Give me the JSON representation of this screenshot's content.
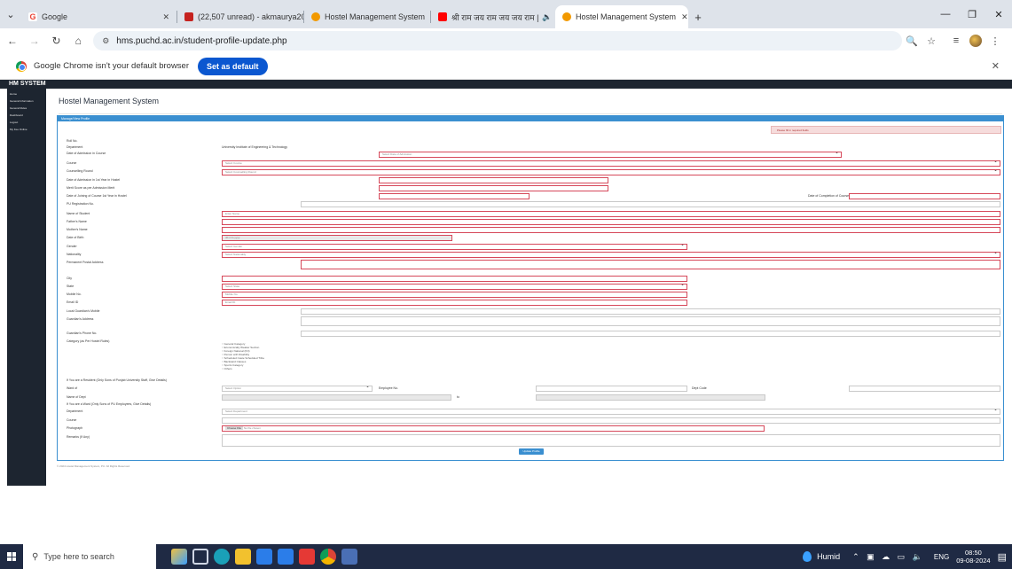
{
  "browser": {
    "tabs": [
      {
        "label": "Google",
        "color": "#ea4335",
        "active": false
      },
      {
        "label": "(22,507 unread) - akmaurya20",
        "color": "#c5221f",
        "active": false
      },
      {
        "label": "Hostel Management System",
        "color": "#f29900",
        "active": false
      },
      {
        "label": "श्री राम जय राम जय जय राम |",
        "color": "#ff0000",
        "active": false
      },
      {
        "label": "Hostel Management System",
        "color": "#f29900",
        "active": true
      }
    ],
    "url": "hms.puchd.ac.in/student-profile-update.php",
    "banner_text": "Google Chrome isn't your default browser",
    "banner_button": "Set as default"
  },
  "app": {
    "brand": "HM SYSTEM",
    "sidebar": [
      "Home",
      "General Information",
      "General Rules",
      "Dashboard",
      "Logout",
      "My Fee Online"
    ],
    "page_title": "Hostel Management System",
    "panel_title": "Manage/View Profile",
    "alert": "Please fill in required fields",
    "fields": {
      "roll_no": "Roll No.",
      "department": "Department",
      "department_value": "University Institute of Engineering & Technology",
      "date_admission": "Date of Admission in Course",
      "date_admission_ph": "Select Date of Admission",
      "course": "Course",
      "course_ph": "Select Course",
      "counselling_round": "Counselling Round",
      "counselling_ph": "Select Counselling Round",
      "date_admission_1st": "Date of Admission in 1st Year in Hostel",
      "merit_score": "Merit Score as per Admission Merit",
      "date_of_join": "Date of Joining of Course 1st Year in Hostel",
      "date_completion": "Date of Completion of Course",
      "pu_registration": "PU Registration No.",
      "name": "Name of Student",
      "name_ph": "Enter Name",
      "father_name": "Father's Name",
      "mother_name": "Mother's Name",
      "dob": "Date of Birth",
      "dob_ph": "dd-mm-yyyy",
      "gender": "Gender",
      "gender_ph": "Select Gender",
      "nationality": "Nationality",
      "nationality_ph": "Select Nationality",
      "permanent_address": "Permanent Postal Address",
      "city": "City",
      "state": "State",
      "state_ph": "Select State",
      "mobile": "Mobile No.",
      "mobile_ph": "Mobile No.",
      "email": "Email ID",
      "email_ph": "Email ID",
      "local_guardian_mobile": "Local Guardian's Mobile",
      "guardian_address": "Guardian's Address",
      "guardian_phone": "Guardian's Phone No.",
      "category": "Category (as Per Hostel Rules)",
      "category_options": [
        "General Category",
        "Economically Weaker Section",
        "Foreign National (FN)",
        "Person with Disability",
        "Scheduled Caste Scheduled Tribe",
        "Backward Classes",
        "Sports Category",
        "Others"
      ],
      "ward_question": "If You are a Resident (Only Sons of Punjab University Staff, Give Details)",
      "ward_of": "Ward of",
      "ward_select_ph": "Select Option",
      "emp_no": "Employee No.",
      "dept_field": "Name of Dept",
      "dept_code": "Dept Code",
      "ward_pu_question": "If You are a Ward (Only Sons of PU Employees, Give Details)",
      "ward_dept": "Department",
      "ward_dept_ph": "Select Department",
      "course_2": "Course",
      "photograph": "Photograph",
      "choose_file": "Choose File",
      "no_file": "No file chosen",
      "remarks": "Remarks (If Any)",
      "update_button": "Update Profile",
      "footer": "© 2024 Hostel Management System, PU. All Rights Reserved."
    }
  },
  "taskbar": {
    "search_placeholder": "Type here to search",
    "weather": "Humid",
    "lang": "ENG",
    "time": "08:50",
    "date": "09-08-2024"
  },
  "colors": {
    "sidebar_bg": "#1d2530",
    "panel_accent": "#3a8fd0",
    "required_border": "#d6485a",
    "alert_bg": "#f6dcdc",
    "chrome_accent": "#0b57d0",
    "taskbar_bg": "#1f2a44"
  }
}
